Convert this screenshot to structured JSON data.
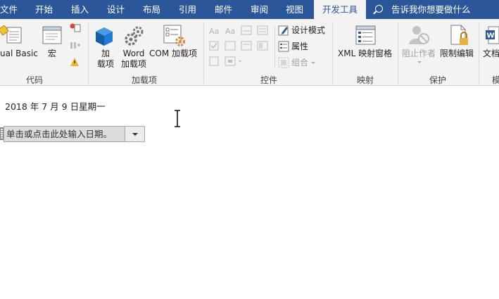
{
  "tabs": [
    {
      "label": "文件"
    },
    {
      "label": "开始"
    },
    {
      "label": "插入"
    },
    {
      "label": "设计"
    },
    {
      "label": "布局"
    },
    {
      "label": "引用"
    },
    {
      "label": "邮件"
    },
    {
      "label": "审阅"
    },
    {
      "label": "视图"
    },
    {
      "label": "开发工具",
      "active": true
    }
  ],
  "tell_me": "告诉我你想要做什么",
  "ribbon": {
    "code": {
      "label": "代码",
      "visual_basic": "ual Basic",
      "macro": "宏"
    },
    "addins": {
      "label": "加载项",
      "addins_line1": "加",
      "addins_line2": "载项",
      "word_line1": "Word",
      "word_line2": "加载项",
      "com": "COM 加载项"
    },
    "controls": {
      "label": "控件",
      "design_mode": "设计模式",
      "properties": "属性",
      "group": "组合"
    },
    "mapping": {
      "label": "映射",
      "xml": "XML 映射窗格"
    },
    "protect": {
      "label": "保护",
      "block_authors": "阻止作者",
      "restrict_editing": "限制编辑"
    },
    "templates": {
      "label": "模",
      "doc": "文档"
    }
  },
  "document": {
    "date_text": "2018 年 7 月 9 日星期一",
    "date_placeholder": "单击或点击此处输入日期。"
  },
  "colors": {
    "tabbar": "#2b579a",
    "ribbon": "#f3f3f3",
    "accent_blue": "#1e7ad6",
    "gear_orange": "#e8872a"
  }
}
